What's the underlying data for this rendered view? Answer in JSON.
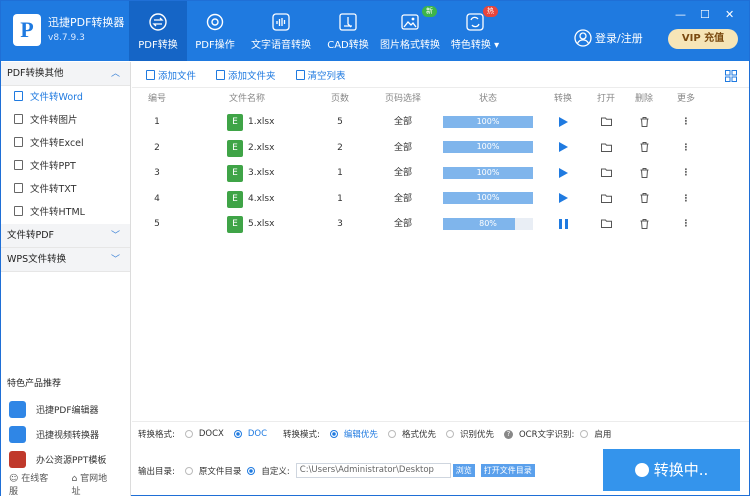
{
  "app": {
    "title": "迅捷PDF转换器",
    "version": "v8.7.9.3",
    "logo_letter": "P"
  },
  "nav": [
    {
      "label": "PDF转换",
      "icon": "swap-icon",
      "active": true
    },
    {
      "label": "PDF操作",
      "icon": "gear-icon"
    },
    {
      "label": "文字语音转换",
      "icon": "audio-wave-icon"
    },
    {
      "label": "CAD转换",
      "icon": "cad-icon"
    },
    {
      "label": "图片格式转换",
      "icon": "image-icon",
      "badge": "新"
    },
    {
      "label": "特色转换",
      "icon": "sync-icon",
      "badge": "热"
    }
  ],
  "window": {
    "minimize": "—",
    "maximize": "☐",
    "close": "✕"
  },
  "login": {
    "label": "登录/注册"
  },
  "vip": {
    "label": "VIP 充值"
  },
  "sidebar": {
    "groups": [
      {
        "title": "PDF转换其他",
        "expanded": true,
        "items": [
          {
            "label": "文件转Word",
            "active": true
          },
          {
            "label": "文件转图片"
          },
          {
            "label": "文件转Excel"
          },
          {
            "label": "文件转PPT"
          },
          {
            "label": "文件转TXT"
          },
          {
            "label": "文件转HTML"
          }
        ]
      },
      {
        "title": "文件转PDF",
        "expanded": false
      },
      {
        "title": "WPS文件转换",
        "expanded": false
      }
    ],
    "recommend_title": "特色产品推荐",
    "products": [
      {
        "label": "迅捷PDF编辑器",
        "color": "#2f86e6"
      },
      {
        "label": "迅捷视频转换器",
        "color": "#2f86e6"
      },
      {
        "label": "办公资源PPT模板",
        "color": "#c0392b"
      }
    ],
    "footer": {
      "service": "在线客服",
      "website": "官网地址"
    }
  },
  "toolbar": {
    "add_file": "添加文件",
    "add_folder": "添加文件夹",
    "clear": "清空列表"
  },
  "table": {
    "headers": [
      "编号",
      "文件名称",
      "页数",
      "页码选择",
      "状态",
      "转换",
      "打开",
      "删除",
      "更多"
    ],
    "rows": [
      {
        "no": "1",
        "name": "1.xlsx",
        "pages": "5",
        "range": "全部",
        "progress": 100,
        "status": "100%",
        "state": "play"
      },
      {
        "no": "2",
        "name": "2.xlsx",
        "pages": "2",
        "range": "全部",
        "progress": 100,
        "status": "100%",
        "state": "play"
      },
      {
        "no": "3",
        "name": "3.xlsx",
        "pages": "1",
        "range": "全部",
        "progress": 100,
        "status": "100%",
        "state": "play"
      },
      {
        "no": "4",
        "name": "4.xlsx",
        "pages": "1",
        "range": "全部",
        "progress": 100,
        "status": "100%",
        "state": "play"
      },
      {
        "no": "5",
        "name": "5.xlsx",
        "pages": "3",
        "range": "全部",
        "progress": 80,
        "status": "80%",
        "state": "pause"
      }
    ]
  },
  "options": {
    "format_label": "转换格式:",
    "format_docx": "DOCX",
    "format_doc": "DOC",
    "mode_label": "转换模式:",
    "mode_edit": "编辑优先",
    "mode_format": "格式优先",
    "mode_ocr": "识别优先",
    "ocr_label": "OCR文字识别:",
    "ocr_enable": "启用"
  },
  "output": {
    "label": "输出目录:",
    "source_dir": "原文件目录",
    "custom": "自定义:",
    "path": "C:\\Users\\Administrator\\Desktop",
    "browse": "浏览",
    "open_dir": "打开文件目录"
  },
  "convert_button": "转换中.."
}
